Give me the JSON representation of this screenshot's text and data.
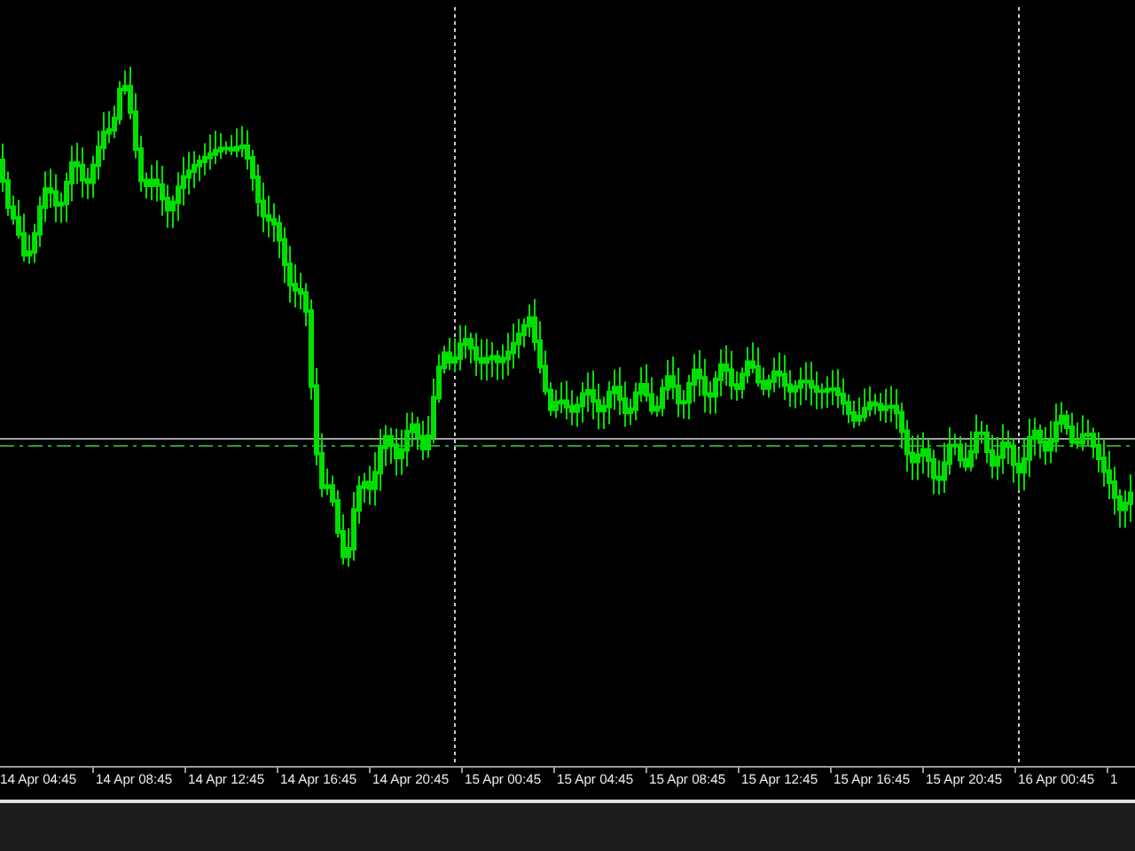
{
  "time_axis": {
    "labels": [
      "14 Apr 04:45",
      "14 Apr 08:45",
      "14 Apr 12:45",
      "14 Apr 16:45",
      "14 Apr 20:45",
      "15 Apr 00:45",
      "15 Apr 04:45",
      "15 Apr 08:45",
      "15 Apr 12:45",
      "15 Apr 16:45",
      "15 Apr 20:45",
      "16 Apr 00:45",
      "1"
    ]
  }
}
